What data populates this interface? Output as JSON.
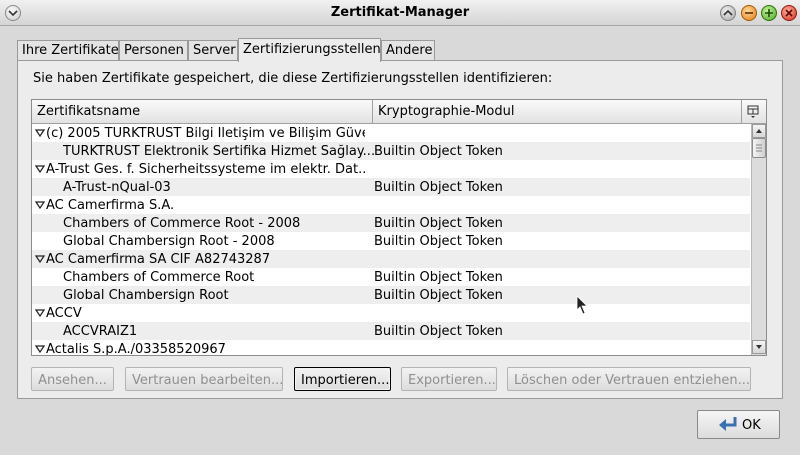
{
  "window": {
    "title": "Zertifikat-Manager"
  },
  "tabs": [
    {
      "label": "Ihre Zertifikate",
      "active": false
    },
    {
      "label": "Personen",
      "active": false
    },
    {
      "label": "Server",
      "active": false
    },
    {
      "label": "Zertifizierungsstellen",
      "active": true
    },
    {
      "label": "Andere",
      "active": false
    }
  ],
  "intro_text": "Sie haben Zertifikate gespeichert, die diese Zertifizierungsstellen identifizieren:",
  "tree": {
    "columns": [
      "Zertifikatsname",
      "Kryptographie-Modul"
    ],
    "column_picker_icon": "column-picker-icon",
    "rows": [
      {
        "name": "(c) 2005 TÜRKTRUST Bilgi İletişim ve Bilişim Güve...",
        "module": "",
        "group": true
      },
      {
        "name": "TÜRKTRUST Elektronik Sertifika Hizmet Sağlay...",
        "module": "Builtin Object Token",
        "group": false
      },
      {
        "name": "A-Trust Ges. f. Sicherheitssysteme im elektr. Dat...",
        "module": "",
        "group": true
      },
      {
        "name": "A-Trust-nQual-03",
        "module": "Builtin Object Token",
        "group": false
      },
      {
        "name": "AC Camerfirma S.A.",
        "module": "",
        "group": true
      },
      {
        "name": "Chambers of Commerce Root - 2008",
        "module": "Builtin Object Token",
        "group": false
      },
      {
        "name": "Global Chambersign Root - 2008",
        "module": "Builtin Object Token",
        "group": false
      },
      {
        "name": "AC Camerfirma SA CIF A82743287",
        "module": "",
        "group": true
      },
      {
        "name": "Chambers of Commerce Root",
        "module": "Builtin Object Token",
        "group": false
      },
      {
        "name": "Global Chambersign Root",
        "module": "Builtin Object Token",
        "group": false
      },
      {
        "name": "ACCV",
        "module": "",
        "group": true
      },
      {
        "name": "ACCVRAIZ1",
        "module": "Builtin Object Token",
        "group": false
      },
      {
        "name": "Actalis S.p.A./03358520967",
        "module": "",
        "group": true
      }
    ]
  },
  "buttons": {
    "view": "Ansehen...",
    "edit_trust": "Vertrauen bearbeiten...",
    "import": "Importieren...",
    "export": "Exportieren...",
    "delete": "Löschen oder Vertrauen entziehen...",
    "ok": "OK"
  },
  "colors": {
    "window_bg": "#d9d9d9",
    "panel_bg": "#ececec",
    "row_alt": "#eeeeee",
    "disabled_text": "#8f8f8f"
  }
}
